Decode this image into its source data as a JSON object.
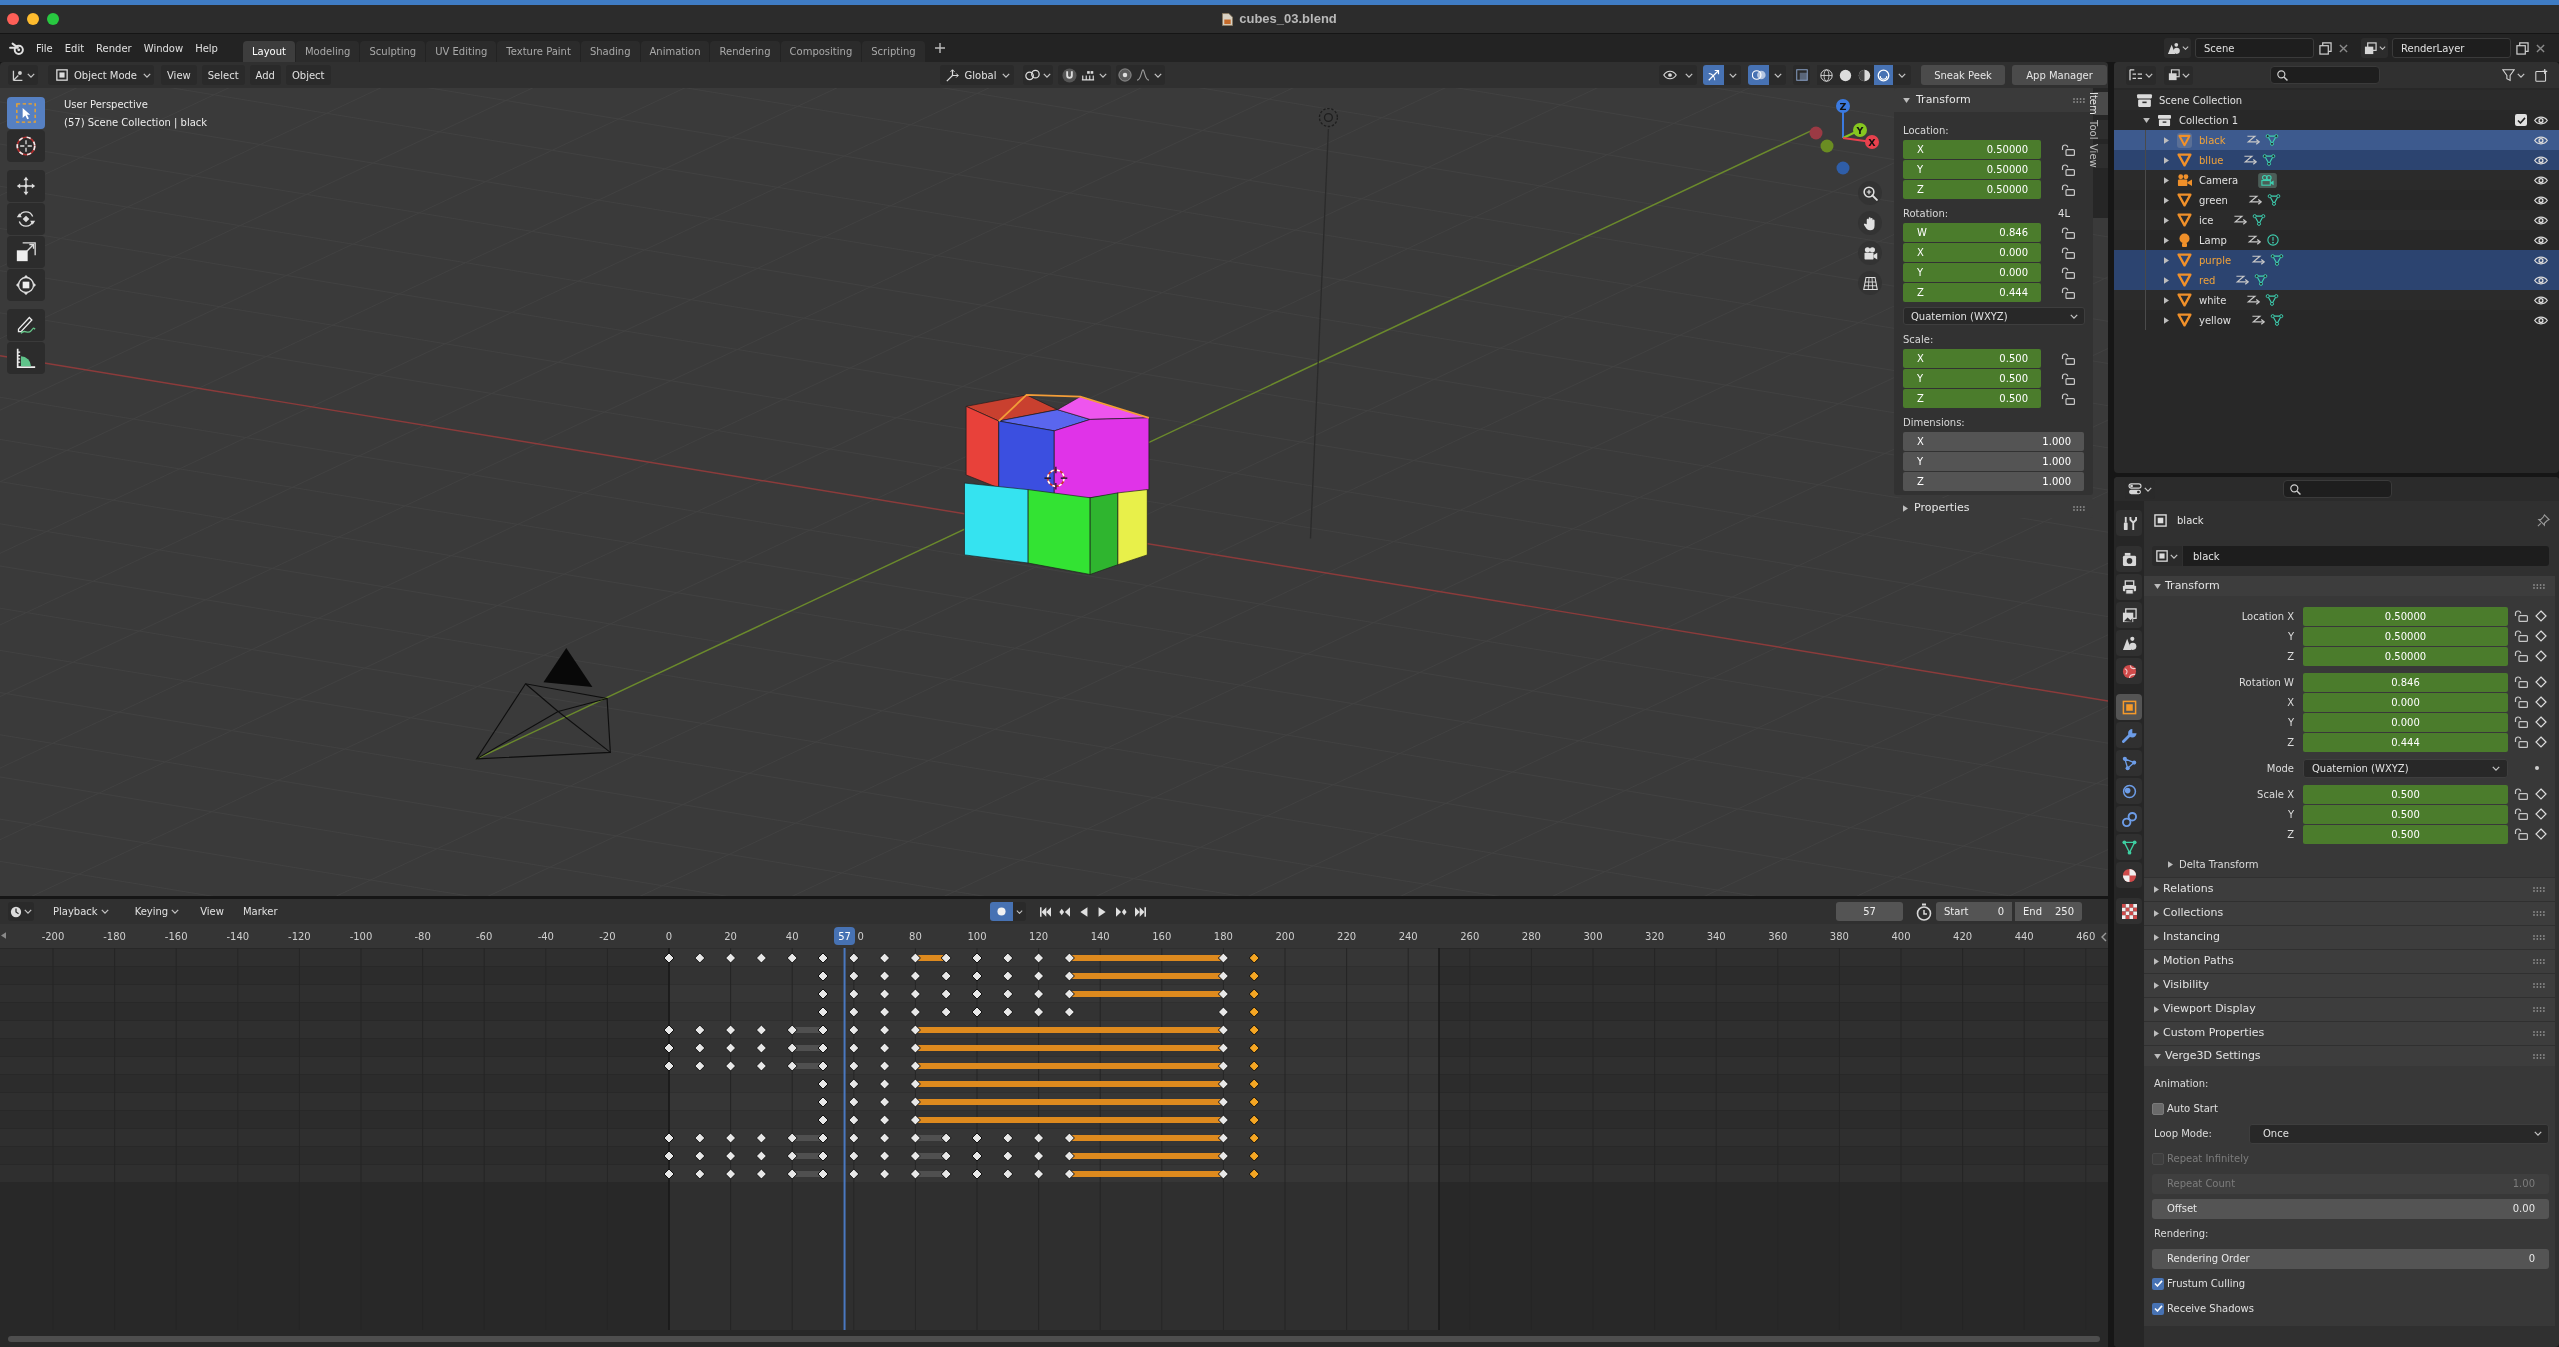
{
  "window": {
    "title": "cubes_03.blend"
  },
  "topbar": {
    "menus": [
      "File",
      "Edit",
      "Render",
      "Window",
      "Help"
    ],
    "workspaces": [
      {
        "label": "Layout",
        "selected": true
      },
      {
        "label": "Modeling",
        "selected": false
      },
      {
        "label": "Sculpting",
        "selected": false
      },
      {
        "label": "UV Editing",
        "selected": false
      },
      {
        "label": "Texture Paint",
        "selected": false
      },
      {
        "label": "Shading",
        "selected": false
      },
      {
        "label": "Animation",
        "selected": false
      },
      {
        "label": "Rendering",
        "selected": false
      },
      {
        "label": "Compositing",
        "selected": false
      },
      {
        "label": "Scripting",
        "selected": false
      }
    ],
    "scene": "Scene",
    "view_layer": "RenderLayer"
  },
  "viewport": {
    "header": {
      "mode": "Object Mode",
      "menus": [
        "View",
        "Select",
        "Add",
        "Object"
      ],
      "orientation": "Global",
      "toggles": [
        {
          "kind": "visibility",
          "selected": false
        },
        {
          "kind": "gizmo",
          "selected": true
        },
        {
          "kind": "overlay",
          "selected": true
        },
        {
          "kind": "xray",
          "selected": false
        }
      ],
      "shading": [
        {
          "kind": "wireframe",
          "selected": false
        },
        {
          "kind": "solid",
          "selected": false
        },
        {
          "kind": "material",
          "selected": false
        },
        {
          "kind": "rendered",
          "selected": true
        }
      ],
      "buttons": [
        "Sneak Peek",
        "App Manager"
      ]
    },
    "info": [
      "User Perspective",
      "(57) Scene Collection | black"
    ],
    "toolbar": [
      {
        "tools": [
          {
            "kind": "select",
            "selected": true
          },
          {
            "kind": "cursor",
            "selected": false
          }
        ]
      },
      {
        "tools": [
          {
            "kind": "move",
            "selected": false
          },
          {
            "kind": "rotate",
            "selected": false
          },
          {
            "kind": "scale",
            "selected": false
          },
          {
            "kind": "transform",
            "selected": false
          }
        ]
      },
      {
        "tools": [
          {
            "kind": "annotate",
            "selected": false
          },
          {
            "kind": "measure",
            "selected": false
          }
        ]
      }
    ],
    "gizmo": {
      "axes": [
        "X",
        "Y",
        "Z"
      ]
    },
    "sidebar": {
      "tabs": [
        {
          "label": "Item",
          "selected": true
        },
        {
          "label": "Tool",
          "selected": false
        },
        {
          "label": "View",
          "selected": false
        }
      ],
      "panels": [
        {
          "title": "Transform",
          "expanded": true,
          "groups": [
            {
              "label": "Location:",
              "lockable": true,
              "fields": [
                {
                  "axis": "X",
                  "value": "0.50000",
                  "animated": true
                },
                {
                  "axis": "Y",
                  "value": "0.50000",
                  "animated": true
                },
                {
                  "axis": "Z",
                  "value": "0.50000",
                  "animated": true
                }
              ]
            },
            {
              "label": "Rotation:",
              "toggle": "4L",
              "lockable": true,
              "fields": [
                {
                  "axis": "W",
                  "value": "0.846",
                  "animated": true
                },
                {
                  "axis": "X",
                  "value": "0.000",
                  "animated": true
                },
                {
                  "axis": "Y",
                  "value": "0.000",
                  "animated": true
                },
                {
                  "axis": "Z",
                  "value": "0.444",
                  "animated": true
                }
              ],
              "mode": "Quaternion (WXYZ)"
            },
            {
              "label": "Scale:",
              "lockable": true,
              "fields": [
                {
                  "axis": "X",
                  "value": "0.500",
                  "animated": true
                },
                {
                  "axis": "Y",
                  "value": "0.500",
                  "animated": true
                },
                {
                  "axis": "Z",
                  "value": "0.500",
                  "animated": true
                }
              ]
            },
            {
              "label": "Dimensions:",
              "lockable": false,
              "fields": [
                {
                  "axis": "X",
                  "value": "1.000",
                  "animated": false
                },
                {
                  "axis": "Y",
                  "value": "1.000",
                  "animated": false
                },
                {
                  "axis": "Z",
                  "value": "1.000",
                  "animated": false
                }
              ]
            }
          ]
        },
        {
          "title": "Properties",
          "expanded": false
        }
      ]
    }
  },
  "outliner": {
    "root": "Scene Collection",
    "collection": {
      "name": "Collection 1",
      "expanded": true,
      "checked": true
    },
    "items": [
      {
        "name": "black",
        "kind": "mesh",
        "selected": true,
        "active": true
      },
      {
        "name": "bllue",
        "kind": "mesh",
        "selected": true,
        "active": false
      },
      {
        "name": "Camera",
        "kind": "camera",
        "selected": false,
        "active": false
      },
      {
        "name": "green",
        "kind": "mesh",
        "selected": false,
        "active": false
      },
      {
        "name": "ice",
        "kind": "mesh",
        "selected": false,
        "active": false
      },
      {
        "name": "Lamp",
        "kind": "lamp",
        "selected": false,
        "active": false
      },
      {
        "name": "purple",
        "kind": "mesh",
        "selected": true,
        "active": false
      },
      {
        "name": "red",
        "kind": "mesh",
        "selected": true,
        "active": false
      },
      {
        "name": "white",
        "kind": "mesh",
        "selected": false,
        "active": false
      },
      {
        "name": "yellow",
        "kind": "mesh",
        "selected": false,
        "active": false
      }
    ]
  },
  "properties": {
    "tab_groups": [
      {
        "tabs": [
          {
            "kind": "tool",
            "selected": false
          }
        ]
      },
      {
        "tabs": [
          {
            "kind": "render",
            "selected": false
          },
          {
            "kind": "output",
            "selected": false
          },
          {
            "kind": "viewlayer",
            "selected": false
          },
          {
            "kind": "scene",
            "selected": false
          },
          {
            "kind": "world",
            "selected": false
          }
        ]
      },
      {
        "tabs": [
          {
            "kind": "object",
            "selected": true
          },
          {
            "kind": "modifiers",
            "selected": false
          },
          {
            "kind": "particles",
            "selected": false
          },
          {
            "kind": "physics",
            "selected": false
          },
          {
            "kind": "constraints",
            "selected": false
          },
          {
            "kind": "data",
            "selected": false
          },
          {
            "kind": "material",
            "selected": false
          }
        ]
      },
      {
        "tabs": [
          {
            "kind": "texture",
            "selected": false
          }
        ]
      }
    ],
    "context": "black",
    "object_name": "black",
    "panels": [
      {
        "title": "Transform",
        "expanded": true,
        "groups": [
          {
            "rows": [
              {
                "kind": "number",
                "label": "Location X",
                "value": "0.50000",
                "animated": true
              },
              {
                "kind": "number",
                "label": "Y",
                "value": "0.50000",
                "animated": true
              },
              {
                "kind": "number",
                "label": "Z",
                "value": "0.50000",
                "animated": true
              }
            ]
          },
          {
            "rows": [
              {
                "kind": "number",
                "label": "Rotation W",
                "value": "0.846",
                "animated": true
              },
              {
                "kind": "number",
                "label": "X",
                "value": "0.000",
                "animated": true
              },
              {
                "kind": "number",
                "label": "Y",
                "value": "0.000",
                "animated": true
              },
              {
                "kind": "number",
                "label": "Z",
                "value": "0.444",
                "animated": true
              }
            ]
          },
          {
            "rows": [
              {
                "kind": "select",
                "label": "Mode",
                "value": "Quaternion (WXYZ)"
              }
            ]
          },
          {
            "rows": [
              {
                "kind": "number",
                "label": "Scale X",
                "value": "0.500",
                "animated": true
              },
              {
                "kind": "number",
                "label": "Y",
                "value": "0.500",
                "animated": true
              },
              {
                "kind": "number",
                "label": "Z",
                "value": "0.500",
                "animated": true
              }
            ]
          }
        ],
        "subpanels": [
          {
            "title": "Delta Transform",
            "expanded": false
          }
        ]
      },
      {
        "title": "Relations",
        "expanded": false
      },
      {
        "title": "Collections",
        "expanded": false
      },
      {
        "title": "Instancing",
        "expanded": false
      },
      {
        "title": "Motion Paths",
        "expanded": false
      },
      {
        "title": "Visibility",
        "expanded": false
      },
      {
        "title": "Viewport Display",
        "expanded": false
      },
      {
        "title": "Custom Properties",
        "expanded": false
      },
      {
        "title": "Verge3D Settings",
        "expanded": true,
        "rows": [
          {
            "kind": "heading",
            "label": "Animation:"
          },
          {
            "kind": "checkbox",
            "label": "Auto Start",
            "checked": false,
            "disabled": false
          },
          {
            "kind": "select",
            "label": "Loop Mode:",
            "value": "Once"
          },
          {
            "kind": "checkbox",
            "label": "Repeat Infinitely",
            "checked": false,
            "disabled": true
          },
          {
            "kind": "number",
            "label": "Repeat Count",
            "value": "1.00",
            "disabled": true
          },
          {
            "kind": "number",
            "label": "Offset",
            "value": "0.00",
            "disabled": false
          },
          {
            "kind": "heading",
            "label": "Rendering:"
          },
          {
            "kind": "number",
            "label": "Rendering Order",
            "value": "0",
            "disabled": false
          },
          {
            "kind": "checkbox",
            "label": "Frustum Culling",
            "checked": true,
            "disabled": false
          },
          {
            "kind": "checkbox",
            "label": "Receive Shadows",
            "checked": true,
            "disabled": false
          }
        ]
      }
    ]
  },
  "timeline": {
    "menus": [
      {
        "label": "Playback",
        "dropdown": true
      },
      {
        "label": "Keying",
        "dropdown": true
      },
      {
        "label": "View",
        "dropdown": false
      },
      {
        "label": "Marker",
        "dropdown": false
      }
    ],
    "auto_keying": true,
    "controls": [
      {
        "kind": "jump_start"
      },
      {
        "kind": "prev_key"
      },
      {
        "kind": "reverse"
      },
      {
        "kind": "play"
      },
      {
        "kind": "next_key"
      },
      {
        "kind": "jump_end"
      }
    ],
    "current_frame": "57",
    "start": {
      "label": "Start",
      "value": "0"
    },
    "end": {
      "label": "End",
      "value": "250"
    },
    "ruler": [
      "-200",
      "-180",
      "-160",
      "-140",
      "-120",
      "-100",
      "-80",
      "-60",
      "-40",
      "-20",
      "0",
      "20",
      "40",
      "0",
      "80",
      "100",
      "120",
      "140",
      "160",
      "180",
      "200",
      "220",
      "240",
      "260",
      "280",
      "300",
      "320",
      "340",
      "360",
      "380",
      "400",
      "420",
      "440",
      "460"
    ],
    "playhead": "57"
  }
}
